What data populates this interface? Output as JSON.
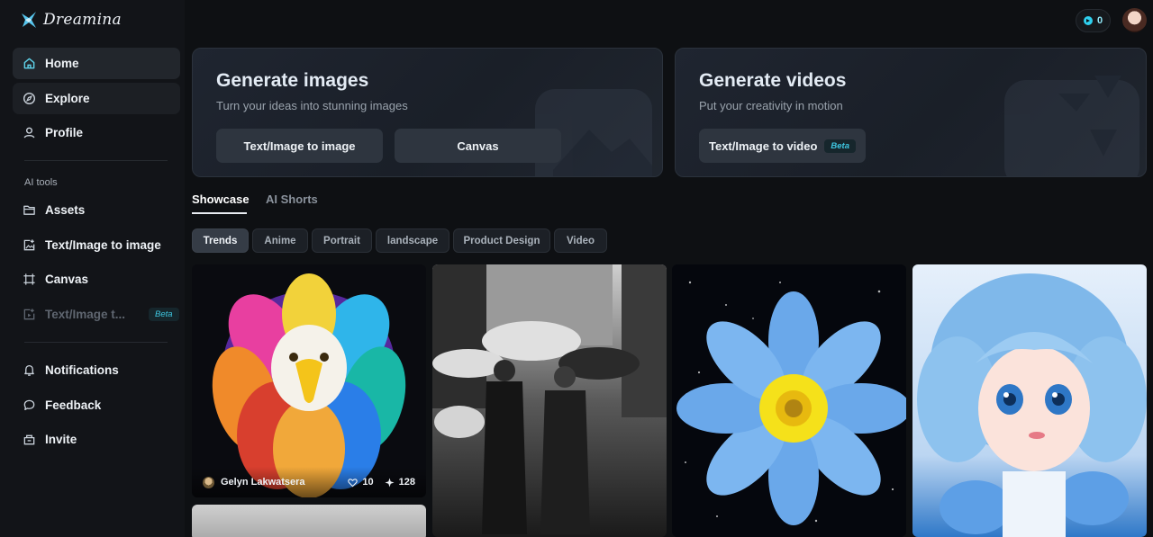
{
  "brand": {
    "name": "Dreamina"
  },
  "sidebar": {
    "main_items": [
      {
        "label": "Home",
        "icon": "home-icon"
      },
      {
        "label": "Explore",
        "icon": "compass-icon"
      },
      {
        "label": "Profile",
        "icon": "user-icon"
      }
    ],
    "section_label": "AI tools",
    "tool_items": [
      {
        "label": "Assets",
        "icon": "folder-icon"
      },
      {
        "label": "Text/Image to image",
        "icon": "image-plus-icon"
      },
      {
        "label": "Canvas",
        "icon": "canvas-icon"
      },
      {
        "label": "Text/Image t...",
        "icon": "video-plus-icon",
        "badge": "Beta"
      }
    ],
    "bottom_items": [
      {
        "label": "Notifications",
        "icon": "bell-icon"
      },
      {
        "label": "Feedback",
        "icon": "chat-icon"
      },
      {
        "label": "Invite",
        "icon": "gift-icon"
      }
    ]
  },
  "topbar": {
    "credits": "0"
  },
  "cards": {
    "images": {
      "title": "Generate images",
      "subtitle": "Turn your ideas into stunning images",
      "buttons": [
        "Text/Image to image",
        "Canvas"
      ]
    },
    "videos": {
      "title": "Generate videos",
      "subtitle": "Put your creativity in motion",
      "button": "Text/Image to video",
      "badge": "Beta"
    }
  },
  "tabs": [
    "Showcase",
    "AI Shorts"
  ],
  "chips": [
    "Trends",
    "Anime",
    "Portrait",
    "landscape",
    "Product Design",
    "Video"
  ],
  "gallery": {
    "first_tile": {
      "author": "Gelyn Lakwatsera",
      "likes": "10",
      "boosts": "128"
    }
  },
  "colors": {
    "accent": "#2fd0ef",
    "background": "#0e1013",
    "card": "#1f2530"
  }
}
